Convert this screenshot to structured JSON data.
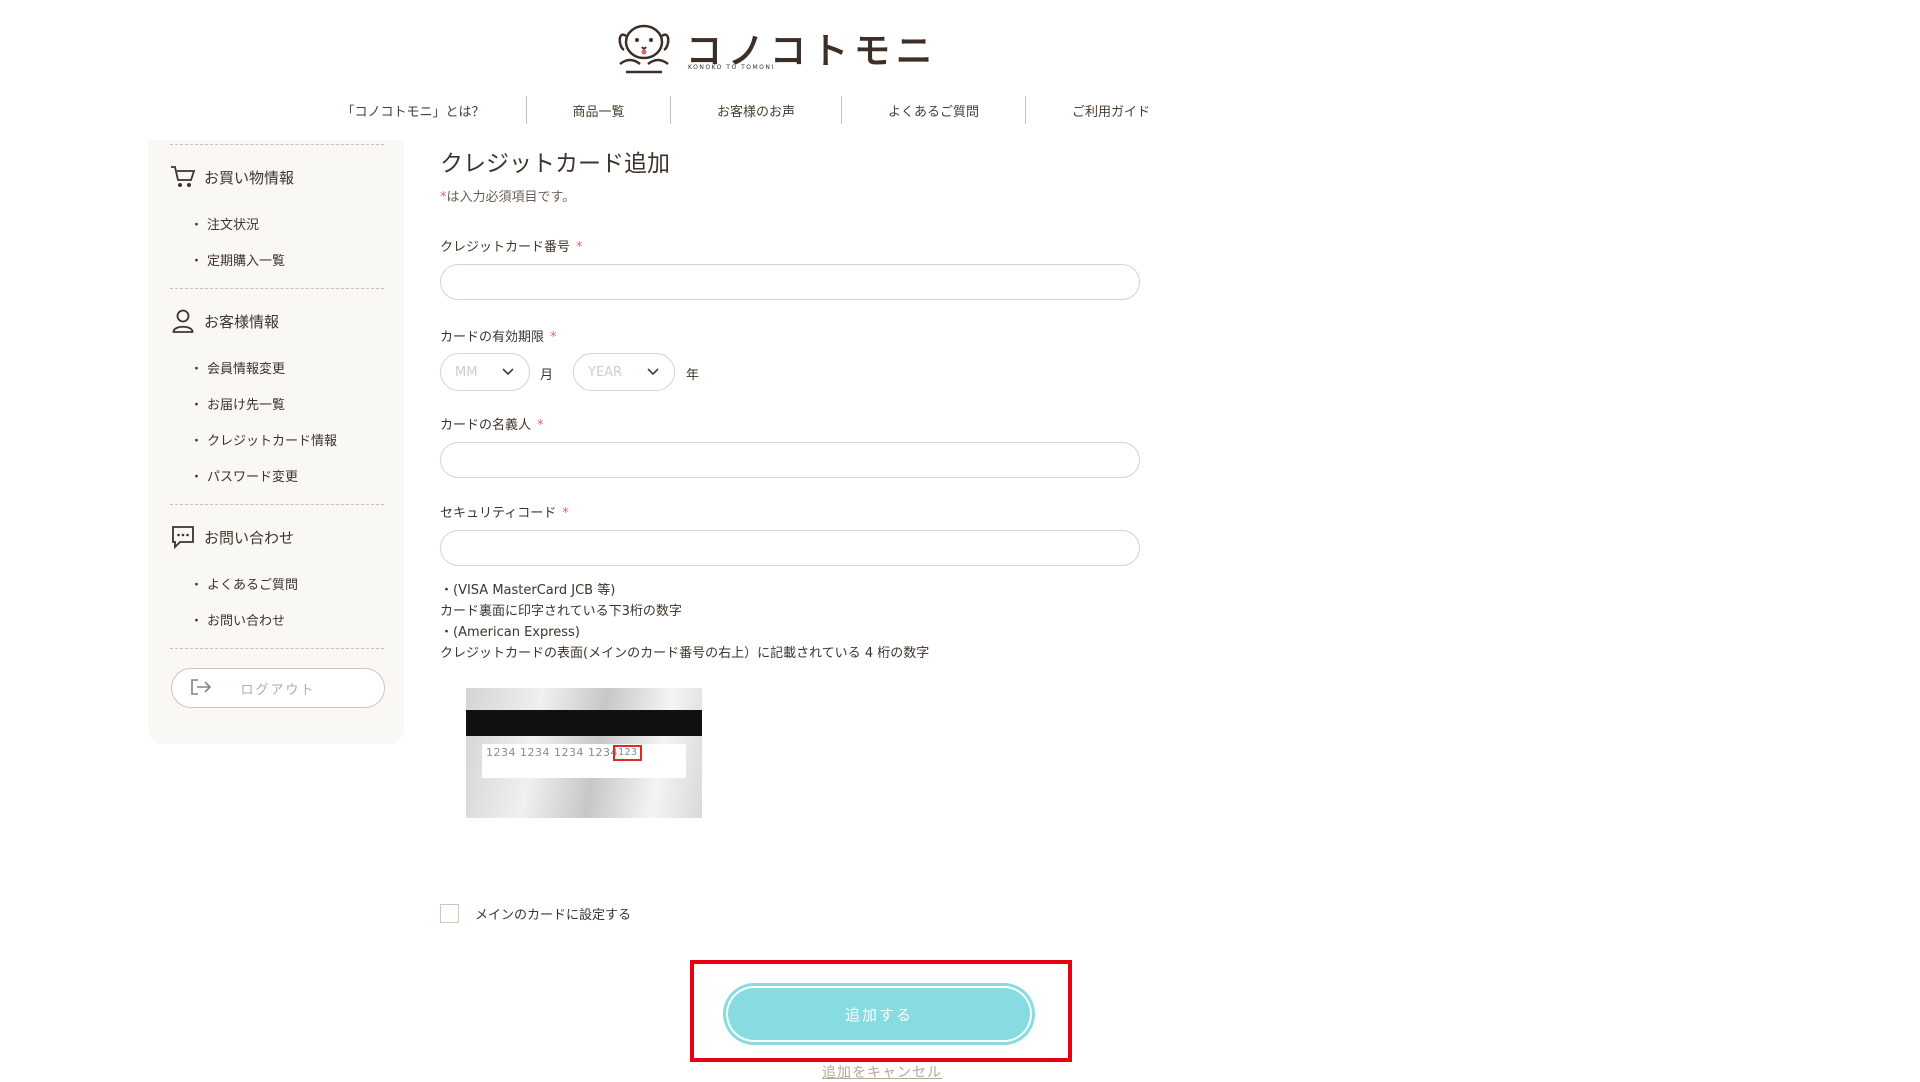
{
  "header": {
    "logo_text": "コノコトモニ",
    "logo_sub": "KONOKO TO TOMONI",
    "nav": [
      {
        "label": "「コノコトモニ」とは？"
      },
      {
        "label": "商品一覧"
      },
      {
        "label": "お客様のお声"
      },
      {
        "label": "よくあるご質問"
      },
      {
        "label": "ご利用ガイド"
      }
    ]
  },
  "sidebar": {
    "shopping": {
      "title": "お買い物情報",
      "icon": "cart-icon",
      "links": [
        "注文状況",
        "定期購入一覧"
      ]
    },
    "customer": {
      "title": "お客様情報",
      "icon": "person-icon",
      "links": [
        "会員情報変更",
        "お届け先一覧",
        "クレジットカード情報",
        "パスワード変更"
      ]
    },
    "contact": {
      "title": "お問い合わせ",
      "icon": "chat-icon",
      "links": [
        "よくあるご質問",
        "お問い合わせ"
      ]
    },
    "logout_label": "ログアウト"
  },
  "form": {
    "title": "クレジットカード追加",
    "required_star": "*",
    "required_note": "は入力必須項目です。",
    "card_number_label": "クレジットカード番号",
    "card_number_value": "",
    "expiry_label": "カードの有効期限",
    "month_placeholder": "MM",
    "month_unit": "月",
    "year_placeholder": "YEAR",
    "year_unit": "年",
    "holder_label": "カードの名義人",
    "holder_value": "",
    "security_label": "セキュリティコード",
    "security_value": "",
    "notes": [
      "・(VISA MasterCard JCB 等)",
      "カード裏面に印字されている下3桁の数字",
      "・(American Express)",
      "クレジットカードの表面(メインのカード番号の右上）に記載されている 4 桁の数字"
    ],
    "card_sample_numbers": "1234  1234  1234  1234",
    "card_sample_cvv": "123",
    "main_card_checkbox_label": "メインのカードに設定する",
    "main_card_checked": false,
    "submit_label": "追加する",
    "cancel_label": "追加をキャンセル"
  },
  "colors": {
    "accent": "#86dce0",
    "highlight": "#e60012",
    "required": "#e16464",
    "sidebar_bg": "#faf8f5"
  }
}
